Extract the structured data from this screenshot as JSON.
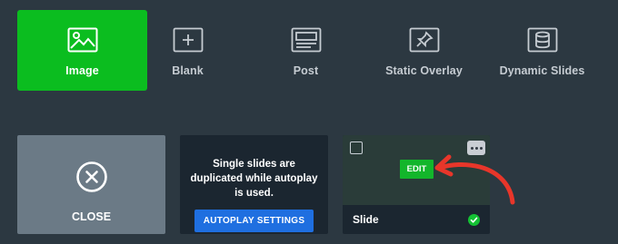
{
  "slide_types": [
    {
      "label": "Image",
      "icon": "image-icon",
      "active": true
    },
    {
      "label": "Blank",
      "icon": "plus-box-icon",
      "active": false
    },
    {
      "label": "Post",
      "icon": "post-icon",
      "active": false
    },
    {
      "label": "Static Overlay",
      "icon": "pin-icon",
      "active": false
    },
    {
      "label": "Dynamic Slides",
      "icon": "database-icon",
      "active": false
    }
  ],
  "close_card": {
    "label": "CLOSE",
    "icon": "close-circle-icon"
  },
  "notice_card": {
    "message": "Single slides are duplicated while autoplay is used.",
    "button_label": "AUTOPLAY SETTINGS"
  },
  "slide_card": {
    "name": "Slide",
    "edit_label": "EDIT",
    "status_icon": "check-circle-icon"
  },
  "colors": {
    "background": "#2c3841",
    "active_tile": "#0bbd1f",
    "primary_button": "#1f6fe0",
    "edit_button": "#13b62b",
    "annotation_arrow": "#e8362a"
  }
}
